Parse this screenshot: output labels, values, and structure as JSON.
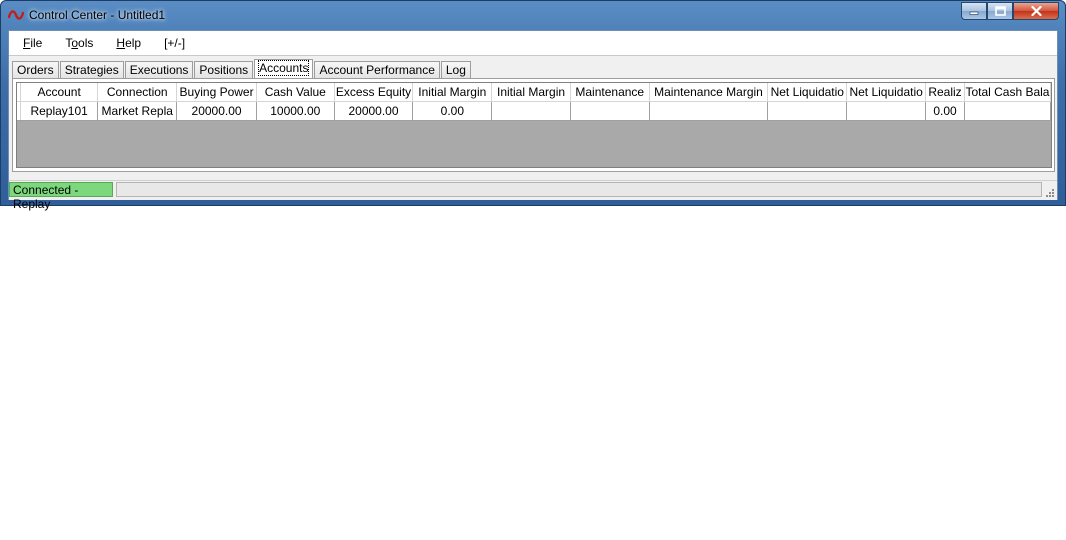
{
  "window": {
    "title": "Control Center - Untitled1",
    "icon": "ninja-wave-icon"
  },
  "window_controls": {
    "minimize_icon": "minimize-icon",
    "maximize_icon": "maximize-icon",
    "close_icon": "close-icon"
  },
  "menubar": {
    "items": [
      {
        "label": "File",
        "access_key": "F"
      },
      {
        "label": "Tools",
        "access_key": "o"
      },
      {
        "label": "Help",
        "access_key": "H"
      },
      {
        "label": "[+/-]"
      }
    ]
  },
  "tabs": [
    {
      "label": "Orders"
    },
    {
      "label": "Strategies"
    },
    {
      "label": "Executions"
    },
    {
      "label": "Positions"
    },
    {
      "label": "Accounts",
      "active": true
    },
    {
      "label": "Account Performance"
    },
    {
      "label": "Log"
    }
  ],
  "accounts_grid": {
    "columns": [
      "Account",
      "Connection",
      "Buying Power",
      "Cash Value",
      "Excess Equity",
      "Initial Margin",
      "Initial Margin",
      "Maintenance",
      "Maintenance Margin",
      "Net Liquidatio",
      "Net Liquidatio",
      "Realiz",
      "Total Cash Bala"
    ],
    "rows": [
      [
        "Replay101",
        "Market Repla",
        "20000.00",
        "10000.00",
        "20000.00",
        "0.00",
        "",
        "",
        "",
        "",
        "",
        "0.00",
        ""
      ]
    ]
  },
  "statusbar": {
    "connection_status": "Connected - Replay",
    "progress": 0.0,
    "colors": {
      "connected": "#7dd87d"
    }
  },
  "colors": {
    "title_bar": "#3d6ea8",
    "grid_background": "#a9a9a9",
    "close_button": "#c3321c"
  }
}
